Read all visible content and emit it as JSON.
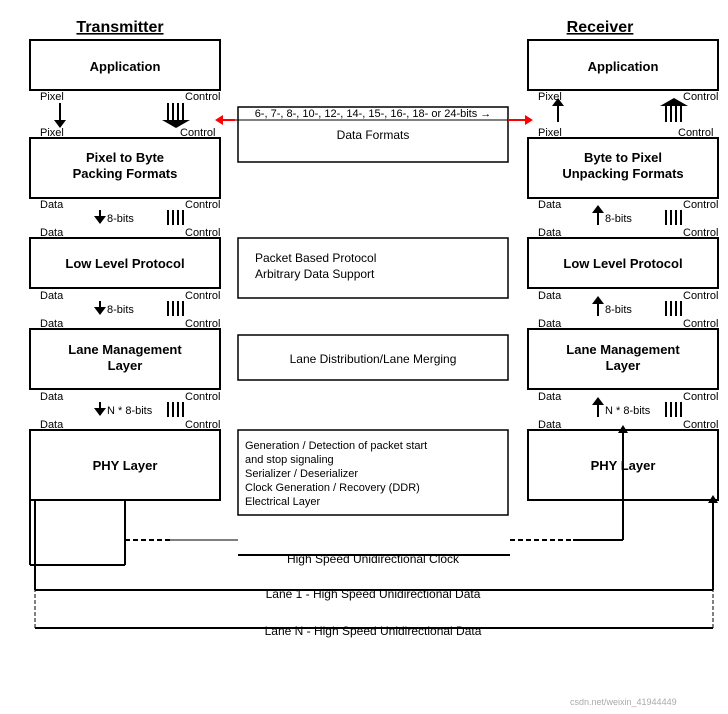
{
  "diagram": {
    "title_left": "Transmitter",
    "title_right": "Receiver",
    "left_layers": [
      {
        "name": "Application",
        "top_labels": [
          "Pixel",
          "Control"
        ]
      },
      {
        "name": "Pixel to Byte\nPacking Formats",
        "top_labels": [
          "Pixel",
          "Control"
        ],
        "bottom_labels": [
          "Data",
          "Control"
        ],
        "bits": "8-bits"
      },
      {
        "name": "Low Level Protocol",
        "top_labels": [
          "Data",
          "Control"
        ],
        "bottom_labels": [
          "Data",
          "Control"
        ],
        "bits": "8-bits"
      },
      {
        "name": "Lane Management\nLayer",
        "top_labels": [
          "Data",
          "Control"
        ],
        "bottom_labels": [
          "Data",
          "Control"
        ],
        "bits": "N * 8-bits"
      },
      {
        "name": "PHY Layer",
        "top_labels": [
          "Data",
          "Control"
        ]
      }
    ],
    "right_layers": [
      {
        "name": "Application",
        "top_labels": [
          "Pixel",
          "Control"
        ]
      },
      {
        "name": "Byte to Pixel\nUnpacking Formats",
        "top_labels": [
          "Pixel",
          "Control"
        ],
        "bottom_labels": [
          "Data",
          "Control"
        ],
        "bits": "8-bits"
      },
      {
        "name": "Low Level Protocol",
        "top_labels": [
          "Data",
          "Control"
        ],
        "bottom_labels": [
          "Data",
          "Control"
        ],
        "bits": "8-bits"
      },
      {
        "name": "Lane Management\nLayer",
        "top_labels": [
          "Data",
          "Control"
        ],
        "bottom_labels": [
          "Data",
          "Control"
        ],
        "bits": "N * 8-bits"
      },
      {
        "name": "PHY Layer",
        "top_labels": [
          "Data",
          "Control"
        ]
      }
    ],
    "middle_boxes": [
      {
        "label": "Data Formats"
      },
      {
        "label": "Packet Based Protocol\nArbitrary Data Support"
      },
      {
        "label": "Lane Distribution/Lane Merging"
      },
      {
        "label": "Generation / Detection of packet start\nand stop signaling\nSerializer / Deserializer\nClock Generation / Recovery (DDR)\nElectrical Layer"
      }
    ],
    "pixel_arrow_label": "6-, 7-, 8-, 10-, 12-, 14-, 15-, 16-, 18- or 24-bits",
    "bottom_lanes": [
      "High Speed Unidirectional Clock",
      "Lane 1 - High Speed Unidirectional Data",
      "Lane N - High Speed Unidirectional Data"
    ],
    "watermark": "csdn.net/weixin_41944449"
  }
}
